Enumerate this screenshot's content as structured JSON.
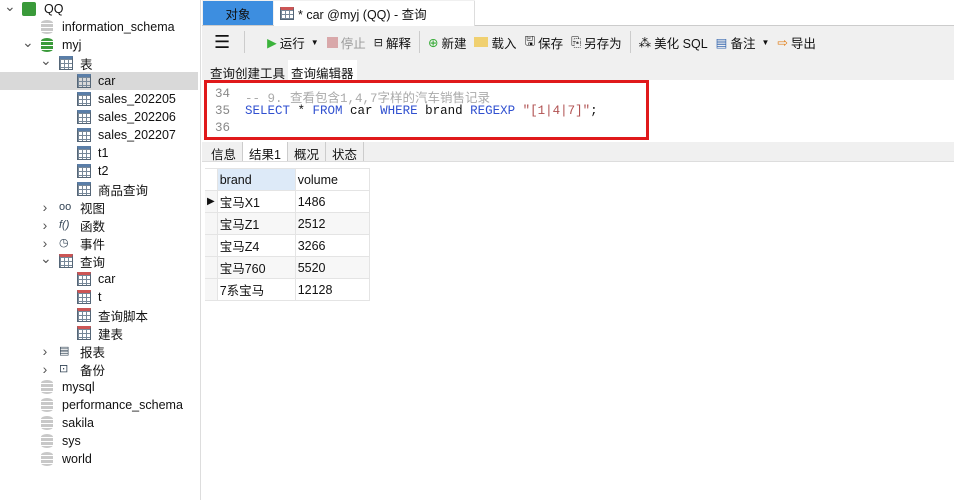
{
  "sidebar": {
    "items": [
      {
        "label": "QQ",
        "level": 0,
        "icon": "mysql-connection-icon",
        "expanded": true
      },
      {
        "label": "information_schema",
        "level": 1,
        "icon": "database-gray-icon"
      },
      {
        "label": "myj",
        "level": 1,
        "icon": "database-green-icon",
        "expanded": true
      },
      {
        "label": "表",
        "level": 2,
        "icon": "tables-folder-icon",
        "expanded": true
      },
      {
        "label": "car",
        "level": 3,
        "icon": "table-icon",
        "selected": true
      },
      {
        "label": "sales_202205",
        "level": 3,
        "icon": "table-icon"
      },
      {
        "label": "sales_202206",
        "level": 3,
        "icon": "table-icon"
      },
      {
        "label": "sales_202207",
        "level": 3,
        "icon": "table-icon"
      },
      {
        "label": "t1",
        "level": 3,
        "icon": "table-icon"
      },
      {
        "label": "t2",
        "level": 3,
        "icon": "table-icon"
      },
      {
        "label": "商品查询",
        "level": 3,
        "icon": "table-icon"
      },
      {
        "label": "视图",
        "level": 2,
        "icon": "views-icon",
        "expanded": false
      },
      {
        "label": "函数",
        "level": 2,
        "icon": "function-icon",
        "expanded": false
      },
      {
        "label": "事件",
        "level": 2,
        "icon": "event-icon",
        "expanded": false
      },
      {
        "label": "查询",
        "level": 2,
        "icon": "query-folder-icon",
        "expanded": true
      },
      {
        "label": "car",
        "level": 3,
        "icon": "query-icon"
      },
      {
        "label": "t",
        "level": 3,
        "icon": "query-icon"
      },
      {
        "label": "查询脚本",
        "level": 3,
        "icon": "query-icon"
      },
      {
        "label": "建表",
        "level": 3,
        "icon": "query-icon"
      },
      {
        "label": "报表",
        "level": 2,
        "icon": "report-icon",
        "expanded": false
      },
      {
        "label": "备份",
        "level": 2,
        "icon": "backup-icon",
        "expanded": false
      },
      {
        "label": "mysql",
        "level": 1,
        "icon": "database-gray-icon"
      },
      {
        "label": "performance_schema",
        "level": 1,
        "icon": "database-gray-icon"
      },
      {
        "label": "sakila",
        "level": 1,
        "icon": "database-gray-icon"
      },
      {
        "label": "sys",
        "level": 1,
        "icon": "database-gray-icon"
      },
      {
        "label": "world",
        "level": 1,
        "icon": "database-gray-icon"
      }
    ]
  },
  "tabs": {
    "objects": "对象",
    "query": "* car @myj (QQ) - 查询"
  },
  "toolbar": {
    "run": "运行",
    "stop": "停止",
    "explain": "解释",
    "new": "新建",
    "load": "载入",
    "save": "保存",
    "save_as": "另存为",
    "beautify": "美化 SQL",
    "comment": "备注",
    "export": "导出"
  },
  "subtabs": [
    "查询创建工具",
    "查询编辑器"
  ],
  "editor": {
    "lines": [
      {
        "no": "34",
        "comment": "-- 9. 查看包含1,4,7字样的汽车销售记录"
      },
      {
        "no": "35",
        "kw1": "SELECT",
        "t1": " * ",
        "kw2": "FROM",
        "t2": " car ",
        "kw3": "WHERE",
        "t3": " brand ",
        "kw4": "REGEXP",
        "t4": " ",
        "str": "\"[1|4|7]\"",
        "t5": ";"
      },
      {
        "no": "36"
      }
    ]
  },
  "result_tabs": [
    "信息",
    "结果1",
    "概况",
    "状态"
  ],
  "result": {
    "columns": [
      "brand",
      "volume"
    ],
    "rows": [
      [
        "宝马X1",
        "1486"
      ],
      [
        "宝马Z1",
        "2512"
      ],
      [
        "宝马Z4",
        "3266"
      ],
      [
        "宝马760",
        "5520"
      ],
      [
        "7系宝马",
        "12128"
      ]
    ]
  }
}
